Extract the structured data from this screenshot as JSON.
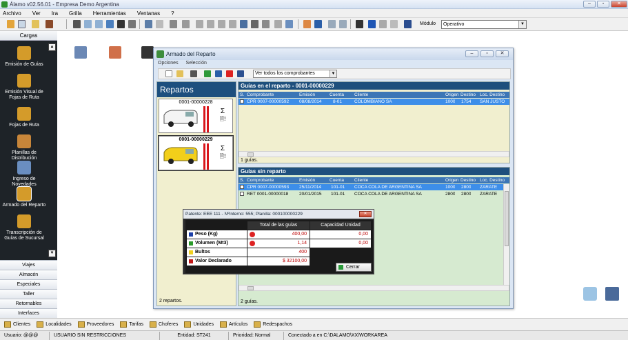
{
  "app": {
    "title": "Álamo v02.56.01 - Empresa Demo Argentina"
  },
  "menu": [
    "Archivo",
    "Ver",
    "Ira",
    "Grilla",
    "Herramientas",
    "Ventanas",
    "?"
  ],
  "toolbar": {
    "modulo_label": "Módulo",
    "modulo_value": "Operativo"
  },
  "sidebar": {
    "header": "Cargas",
    "items": [
      {
        "label": "Emisión de Guías",
        "icon": "box-icon"
      },
      {
        "label": "Emisión Visual de Fojas de Ruta",
        "icon": "box-cursor-icon"
      },
      {
        "label": "Fojas de Ruta",
        "icon": "box-icon"
      },
      {
        "label": "Planillas de Distribución",
        "icon": "hand-box-icon"
      },
      {
        "label": "Ingreso de Novedades",
        "icon": "document-icon"
      },
      {
        "label": "Armado del Reparto",
        "icon": "box-icon"
      },
      {
        "label": "Transcripción de Guías de Sucursal",
        "icon": "box-icon"
      }
    ],
    "sections": [
      "Viajes",
      "Almacén",
      "Especiales",
      "Taller",
      "Retornables",
      "Interfaces"
    ]
  },
  "taskbar": [
    "Clientes",
    "Localidades",
    "Proveedores",
    "Tarifas",
    "Choferes",
    "Unidades",
    "Artículos",
    "Redespachos"
  ],
  "statusbar": {
    "usuario": "Usuario: @@@",
    "restricciones": "USUARIO SIN RESTRICCIONES",
    "entidad": "Entidad: ST241",
    "prioridad": "Prioridad: Normal",
    "conexion": "Conectado a  en C:\\DALAMO\\XX\\WORKAREA"
  },
  "window": {
    "title": "Armado del Reparto",
    "menu": [
      "Opciones",
      "Selección"
    ],
    "filter": "Ver todos los comprobantes",
    "repartos_title": "Repartos",
    "repartos": [
      "0001-00000228",
      "0001-00000229"
    ],
    "repartos_count": "2 repartos.",
    "en_reparto": {
      "title": "Guías en el reparto - 0001-00000229",
      "count": "1 guías.",
      "rows": [
        {
          "comprobante": "CPR 0007-00000592",
          "emision": "08/08/2014",
          "cuenta": "8-01",
          "cliente": "COLOMBIANO SA",
          "origen": "1000",
          "destino": "1754",
          "loc": "SAN JUSTO"
        }
      ]
    },
    "sin_reparto": {
      "title": "Guías sin reparto",
      "count": "2 guías.",
      "rows": [
        {
          "comprobante": "CPR 0007-00000593",
          "emision": "25/11/2014",
          "cuenta": "101-01",
          "cliente": "COCA COLA DE ARGENTINA SA",
          "origen": "1000",
          "destino": "2800",
          "loc": "ZARATE"
        },
        {
          "comprobante": "RET 0001-00000018",
          "emision": "20/01/2015",
          "cuenta": "101-01",
          "cliente": "COCA COLA DE ARGENTINA SA",
          "origen": "2800",
          "destino": "2800",
          "loc": "ZARATE"
        }
      ]
    },
    "columns": {
      "s": "S.",
      "comprobante": "Comprobante",
      "emision": "Emisión",
      "cuenta": "Cuenta",
      "cliente": "Cliente",
      "origen": "Origen",
      "destino": "Destino",
      "loc": "Loc. Destino"
    }
  },
  "popup": {
    "title": "Patente: EEE 111 - NºInterno: 555; Planilla: 000100000229",
    "col_total": "Total de las guías",
    "col_capacidad": "Capacidad Unidad",
    "rows": [
      {
        "label": "Peso (Kg)",
        "color": "#1c3fa8",
        "total": "400,00",
        "capacidad": "0,00",
        "error": true
      },
      {
        "label": "Volumen (Mt3)",
        "color": "#2a9a2a",
        "total": "1,14",
        "capacidad": "0,00",
        "error": true
      },
      {
        "label": "Bultos",
        "color": "#f0d020",
        "total": "400",
        "capacidad": "",
        "error": false
      },
      {
        "label": "Valor Declarado",
        "color": "#c01818",
        "total": "$ 32100,00",
        "capacidad": "",
        "error": false
      }
    ],
    "close_label": "Cerrar"
  }
}
